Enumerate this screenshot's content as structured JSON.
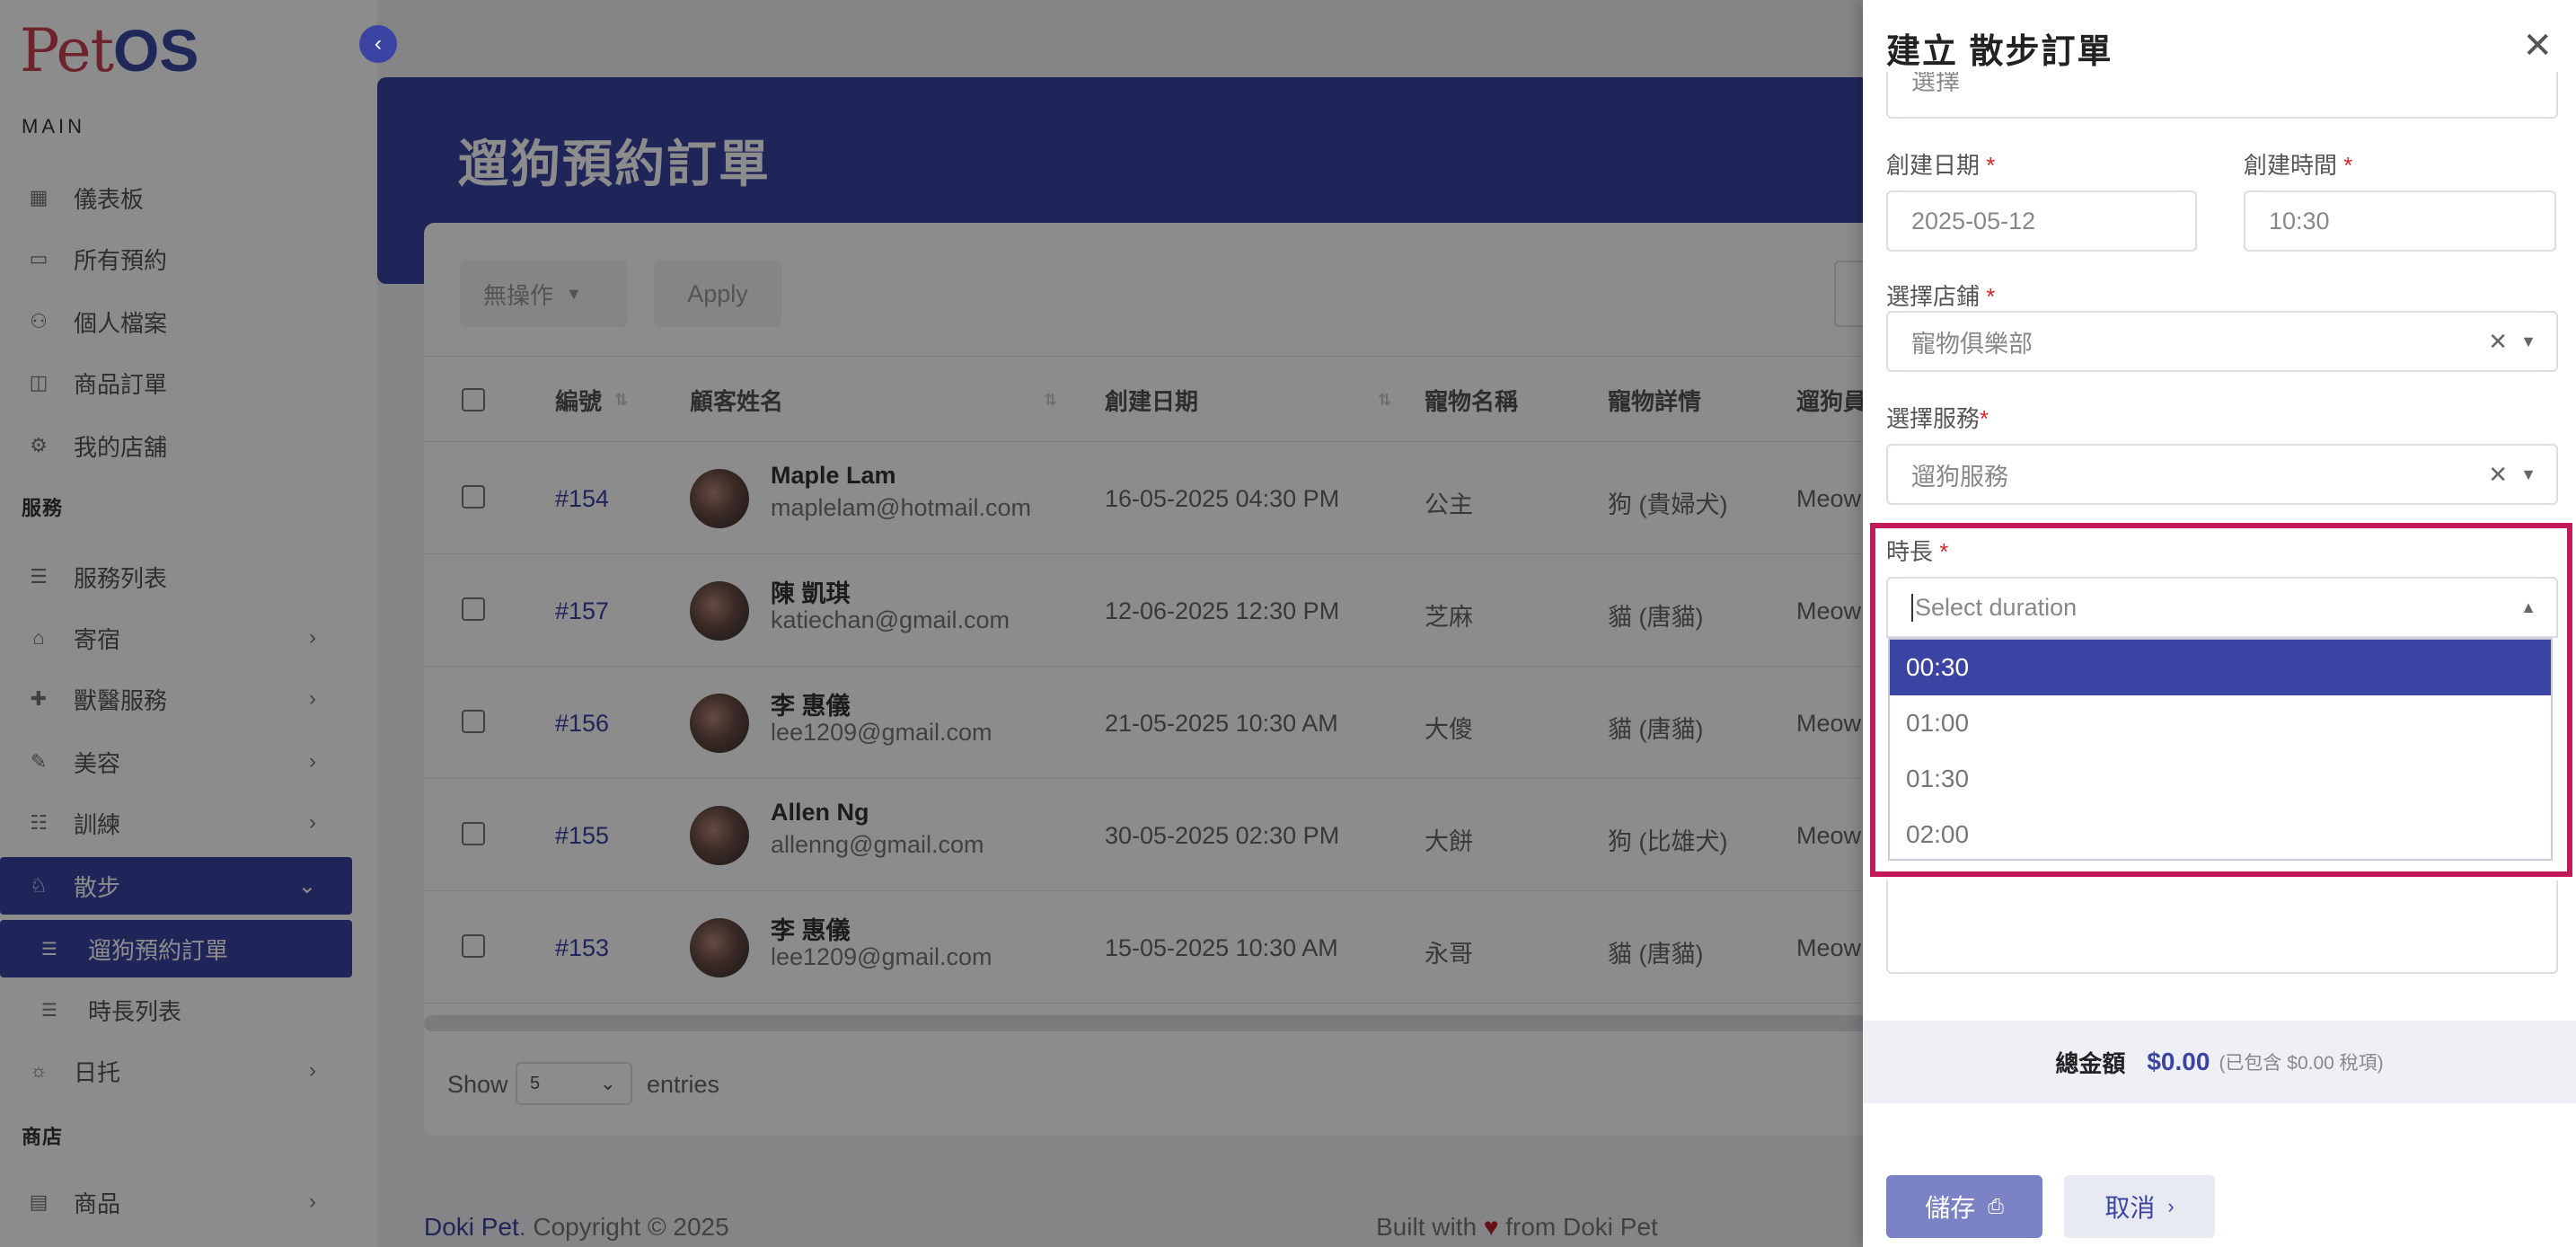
{
  "sidebar": {
    "logo_pet": "Pet",
    "logo_os": "OS",
    "section_main": "MAIN",
    "main_items": [
      {
        "label": "儀表板",
        "icon": "dashboard-icon"
      },
      {
        "label": "所有預約",
        "icon": "calendar-icon"
      },
      {
        "label": "個人檔案",
        "icon": "user-icon"
      },
      {
        "label": "商品訂單",
        "icon": "bag-icon"
      },
      {
        "label": "我的店舖",
        "icon": "store-icon"
      }
    ],
    "section_services": "服務",
    "service_items": [
      {
        "label": "服務列表",
        "icon": "list-icon"
      },
      {
        "label": "寄宿",
        "icon": "home-icon"
      },
      {
        "label": "獸醫服務",
        "icon": "vet-icon"
      },
      {
        "label": "美容",
        "icon": "grooming-icon"
      },
      {
        "label": "訓練",
        "icon": "training-icon"
      },
      {
        "label": "散步",
        "icon": "walk-icon"
      }
    ],
    "walk_sub": [
      {
        "label": "遛狗預約訂單"
      },
      {
        "label": "時長列表"
      }
    ],
    "daycare": {
      "label": "日托"
    },
    "section_shop": "商店",
    "shop_items": [
      {
        "label": "商品"
      }
    ]
  },
  "main": {
    "page_title": "遛狗預約訂單",
    "bulk_action": "無操作",
    "apply": "Apply",
    "columns": [
      "編號",
      "顧客姓名",
      "創建日期",
      "寵物名稱",
      "寵物詳情",
      "遛狗員"
    ],
    "rows": [
      {
        "id": "#154",
        "name": "Maple Lam",
        "email": "maplelam@hotmail.com",
        "date": "16-05-2025 04:30 PM",
        "pet": "公主",
        "detail": "狗 (貴婦犬)",
        "walker": "Meow"
      },
      {
        "id": "#157",
        "name": "陳 凱琪",
        "email": "katiechan@gmail.com",
        "date": "12-06-2025 12:30 PM",
        "pet": "芝麻",
        "detail": "貓 (唐貓)",
        "walker": "Meow"
      },
      {
        "id": "#156",
        "name": "李 惠儀",
        "email": "lee1209@gmail.com",
        "date": "21-05-2025 10:30 AM",
        "pet": "大傻",
        "detail": "貓 (唐貓)",
        "walker": "Meow"
      },
      {
        "id": "#155",
        "name": "Allen Ng",
        "email": "allenng@gmail.com",
        "date": "30-05-2025 02:30 PM",
        "pet": "大餅",
        "detail": "狗 (比雄犬)",
        "walker": "Meow"
      },
      {
        "id": "#153",
        "name": "李 惠儀",
        "email": "lee1209@gmail.com",
        "date": "15-05-2025 10:30 AM",
        "pet": "永哥",
        "detail": "貓 (唐貓)",
        "walker": "Meow"
      }
    ],
    "show": "Show",
    "page_size": "5",
    "entries": "entries"
  },
  "footer": {
    "brand": "Doki Pet",
    "copyright": ". Copyright © 2025",
    "built_prefix": "Built with",
    "heart": "♥",
    "built_suffix": "from Doki Pet"
  },
  "drawer": {
    "title": "建立 散步訂單",
    "top_field_value": "選擇",
    "date_label": "創建日期",
    "date_value": "2025-05-12",
    "time_label": "創建時間",
    "time_value": "10:30",
    "store_label": "選擇店鋪",
    "store_value": "寵物俱樂部",
    "service_label": "選擇服務",
    "service_value": "遛狗服務",
    "duration_label": "時長",
    "duration_placeholder": "Select duration",
    "duration_options": [
      "00:30",
      "01:00",
      "01:30",
      "02:00"
    ],
    "total_label": "總金額",
    "total_amount": "$0.00",
    "tax_note": "(已包含 $0.00 稅項)",
    "save": "儲存",
    "cancel": "取消",
    "required_mark": "*"
  },
  "colors": {
    "primary": "#3b44a3",
    "highlight": "#c2195b",
    "logo_red": "#c94250"
  }
}
